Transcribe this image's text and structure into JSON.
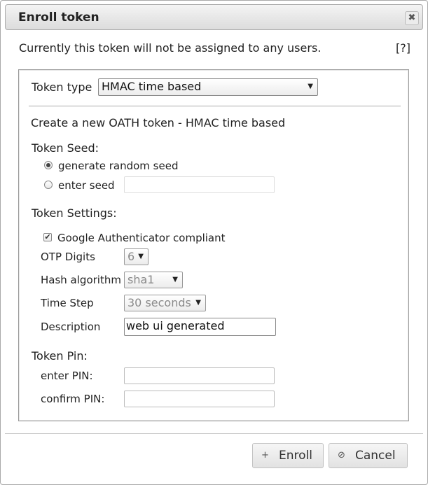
{
  "dialog": {
    "title": "Enroll token",
    "close_glyph": "✖",
    "close_icon": "close-icon",
    "info_text": "Currently this token will not be assigned to any users.",
    "help_label": "[?]"
  },
  "form": {
    "token_type_label": "Token type",
    "token_type_value": "HMAC time based",
    "subtitle": "Create a new OATH token - HMAC time based",
    "seed": {
      "heading": "Token Seed:",
      "option_random": "generate random seed",
      "option_enter": "enter seed",
      "selected": "generate random seed",
      "seed_value": ""
    },
    "settings": {
      "heading": "Token Settings:",
      "google_auth_label": "Google Authenticator compliant",
      "google_auth_checked": true,
      "otp_digits_label": "OTP Digits",
      "otp_digits_value": "6",
      "hash_label": "Hash algorithm",
      "hash_value": "sha1",
      "timestep_label": "Time Step",
      "timestep_value": "30 seconds",
      "description_label": "Description",
      "description_value": "web ui generated"
    },
    "pin": {
      "heading": "Token Pin:",
      "enter_label": "enter PIN:",
      "confirm_label": "confirm PIN:",
      "enter_value": "",
      "confirm_value": ""
    }
  },
  "buttons": {
    "enroll_label": "Enroll",
    "enroll_glyph": "+",
    "cancel_label": "Cancel",
    "cancel_glyph": "⊘"
  }
}
